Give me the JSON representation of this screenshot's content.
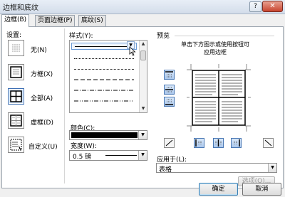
{
  "window": {
    "title": "边框和底纹",
    "help_label": "?",
    "close_label": "✕"
  },
  "tabs": [
    {
      "label": "边框(B)",
      "active": true
    },
    {
      "label": "页面边框(P)",
      "active": false
    },
    {
      "label": "底纹(S)",
      "active": false
    }
  ],
  "settings": {
    "label": "设置:",
    "items": [
      {
        "label": "无(N)",
        "icon": "setting-none-icon"
      },
      {
        "label": "方框(X)",
        "icon": "setting-box-icon"
      },
      {
        "label": "全部(A)",
        "icon": "setting-all-icon",
        "selected": true
      },
      {
        "label": "虚框(D)",
        "icon": "setting-grid-icon"
      },
      {
        "label": "自定义(U)",
        "icon": "setting-custom-icon"
      }
    ]
  },
  "style": {
    "label": "样式(Y):",
    "items": [
      "solid",
      "dotted",
      "dashed-small",
      "dashed-medium",
      "dash-dot",
      "dash-dot-dot"
    ],
    "selected_index": 0
  },
  "color": {
    "label": "颜色(C):",
    "value": "#000000"
  },
  "width": {
    "label": "宽度(W):",
    "value": "0.5 磅"
  },
  "preview": {
    "label": "预览",
    "hint_line1": "单击下方图示或使用按钮可",
    "hint_line2": "应用边框"
  },
  "apply_to": {
    "label": "应用于(L):",
    "value": "表格"
  },
  "options_button": "选项(O)...",
  "footer": {
    "ok_label": "确定",
    "cancel_label": "取消"
  },
  "colors": {
    "accent": "#3c6fb4",
    "selected_fill": "#cfe2f7",
    "dialog_bg": "#f0f0f0"
  }
}
